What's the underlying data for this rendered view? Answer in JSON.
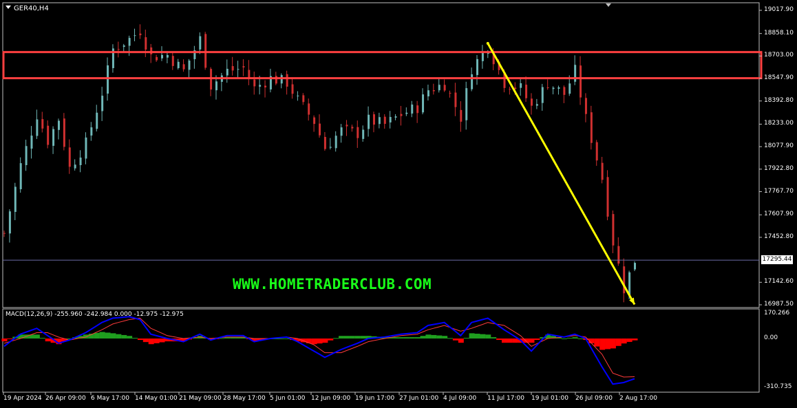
{
  "symbol": "GER40,H4",
  "watermark": "WWW.HOMETRADERCLUB.COM",
  "current_price": "17295.44",
  "macd_label": "MACD(12,26,9) -255.960 -242.984 0.000 -12.975 -12.975",
  "colors": {
    "background": "#000000",
    "up_candle": "#6fb7b7",
    "down_candle": "#d03030",
    "zone": "#ff4040",
    "arrow": "#ffff00",
    "macd_main": "#0000ff",
    "macd_signal": "#ff3b3b",
    "hist_pos": "#1f9f1f",
    "hist_neg": "#ff0000",
    "watermark": "#19ff19"
  },
  "chart_data": [
    {
      "type": "candlestick",
      "symbol": "GER40",
      "timeframe": "H4",
      "y_ticks": [
        "19017.90",
        "18858.10",
        "18703.00",
        "18547.90",
        "18392.80",
        "18233.00",
        "18077.90",
        "17922.80",
        "17767.70",
        "17607.90",
        "17452.80",
        "17295.44",
        "17142.60",
        "16987.50"
      ],
      "ylim": [
        16987.5,
        19017.9
      ],
      "x_ticks": [
        "19 Apr 2024",
        "26 Apr 09:00",
        "6 May 17:00",
        "14 May 01:00",
        "21 May 09:00",
        "28 May 17:00",
        "5 Jun 01:00",
        "12 Jun 09:00",
        "19 Jun 17:00",
        "27 Jun 01:00",
        "4 Jul 09:00",
        "11 Jul 17:00",
        "19 Jul 01:00",
        "26 Jul 09:00",
        "2 Aug 17:00"
      ],
      "close_path": [
        [
          0,
          17480
        ],
        [
          3,
          17950
        ],
        [
          6,
          18300
        ],
        [
          8,
          18120
        ],
        [
          10,
          18270
        ],
        [
          12,
          17930
        ],
        [
          15,
          18100
        ],
        [
          18,
          18450
        ],
        [
          20,
          18750
        ],
        [
          23,
          18820
        ],
        [
          25,
          18880
        ],
        [
          27,
          18700
        ],
        [
          30,
          18710
        ],
        [
          33,
          18600
        ],
        [
          36,
          18820
        ],
        [
          38,
          18500
        ],
        [
          41,
          18600
        ],
        [
          44,
          18620
        ],
        [
          46,
          18480
        ],
        [
          49,
          18550
        ],
        [
          52,
          18520
        ],
        [
          54,
          18400
        ],
        [
          57,
          18250
        ],
        [
          59,
          18070
        ],
        [
          62,
          18190
        ],
        [
          65,
          18170
        ],
        [
          67,
          18260
        ],
        [
          70,
          18230
        ],
        [
          73,
          18300
        ],
        [
          76,
          18350
        ],
        [
          78,
          18470
        ],
        [
          81,
          18510
        ],
        [
          84,
          18280
        ],
        [
          86,
          18620
        ],
        [
          89,
          18770
        ],
        [
          92,
          18520
        ],
        [
          95,
          18480
        ],
        [
          97,
          18350
        ],
        [
          100,
          18520
        ],
        [
          103,
          18440
        ],
        [
          105,
          18600
        ],
        [
          107,
          18270
        ],
        [
          110,
          17860
        ],
        [
          112,
          17420
        ],
        [
          114,
          17100
        ],
        [
          116,
          17295
        ]
      ],
      "resistance_zone": [
        18550,
        18730
      ],
      "arrow": {
        "from": [
          89,
          18790
        ],
        "to": [
          116,
          16990
        ]
      },
      "current_price": 17295.44
    },
    {
      "type": "line+histogram",
      "indicator": "MACD(12,26,9)",
      "y_ticks": [
        "170.266",
        "0.00",
        "-310.735"
      ],
      "ylim": [
        -310.735,
        170.266
      ],
      "macd_main": [
        [
          0,
          -50
        ],
        [
          3,
          30
        ],
        [
          6,
          70
        ],
        [
          8,
          20
        ],
        [
          10,
          -30
        ],
        [
          12,
          -10
        ],
        [
          15,
          40
        ],
        [
          18,
          110
        ],
        [
          20,
          140
        ],
        [
          23,
          150
        ],
        [
          25,
          130
        ],
        [
          27,
          30
        ],
        [
          30,
          0
        ],
        [
          33,
          -20
        ],
        [
          36,
          30
        ],
        [
          38,
          -10
        ],
        [
          41,
          20
        ],
        [
          44,
          20
        ],
        [
          46,
          -20
        ],
        [
          49,
          0
        ],
        [
          52,
          10
        ],
        [
          54,
          -20
        ],
        [
          57,
          -80
        ],
        [
          59,
          -120
        ],
        [
          62,
          -70
        ],
        [
          65,
          -30
        ],
        [
          67,
          0
        ],
        [
          70,
          10
        ],
        [
          73,
          30
        ],
        [
          76,
          40
        ],
        [
          78,
          90
        ],
        [
          81,
          110
        ],
        [
          84,
          20
        ],
        [
          86,
          110
        ],
        [
          89,
          140
        ],
        [
          92,
          60
        ],
        [
          95,
          -10
        ],
        [
          97,
          -80
        ],
        [
          100,
          30
        ],
        [
          103,
          10
        ],
        [
          105,
          30
        ],
        [
          107,
          0
        ],
        [
          110,
          -180
        ],
        [
          112,
          -290
        ],
        [
          114,
          -280
        ],
        [
          116,
          -256
        ]
      ],
      "macd_signal": [
        [
          0,
          -30
        ],
        [
          3,
          0
        ],
        [
          6,
          40
        ],
        [
          8,
          40
        ],
        [
          10,
          10
        ],
        [
          12,
          -10
        ],
        [
          15,
          10
        ],
        [
          18,
          60
        ],
        [
          20,
          100
        ],
        [
          23,
          130
        ],
        [
          25,
          140
        ],
        [
          27,
          70
        ],
        [
          30,
          20
        ],
        [
          33,
          0
        ],
        [
          36,
          10
        ],
        [
          38,
          0
        ],
        [
          41,
          10
        ],
        [
          44,
          10
        ],
        [
          46,
          0
        ],
        [
          49,
          0
        ],
        [
          52,
          10
        ],
        [
          54,
          0
        ],
        [
          57,
          -40
        ],
        [
          59,
          -90
        ],
        [
          62,
          -90
        ],
        [
          65,
          -50
        ],
        [
          67,
          -20
        ],
        [
          70,
          0
        ],
        [
          73,
          20
        ],
        [
          76,
          30
        ],
        [
          78,
          60
        ],
        [
          81,
          90
        ],
        [
          84,
          50
        ],
        [
          86,
          70
        ],
        [
          89,
          110
        ],
        [
          92,
          90
        ],
        [
          95,
          20
        ],
        [
          97,
          -50
        ],
        [
          100,
          0
        ],
        [
          103,
          10
        ],
        [
          105,
          20
        ],
        [
          107,
          10
        ],
        [
          110,
          -100
        ],
        [
          112,
          -220
        ],
        [
          114,
          -245
        ],
        [
          116,
          -243
        ]
      ]
    }
  ]
}
